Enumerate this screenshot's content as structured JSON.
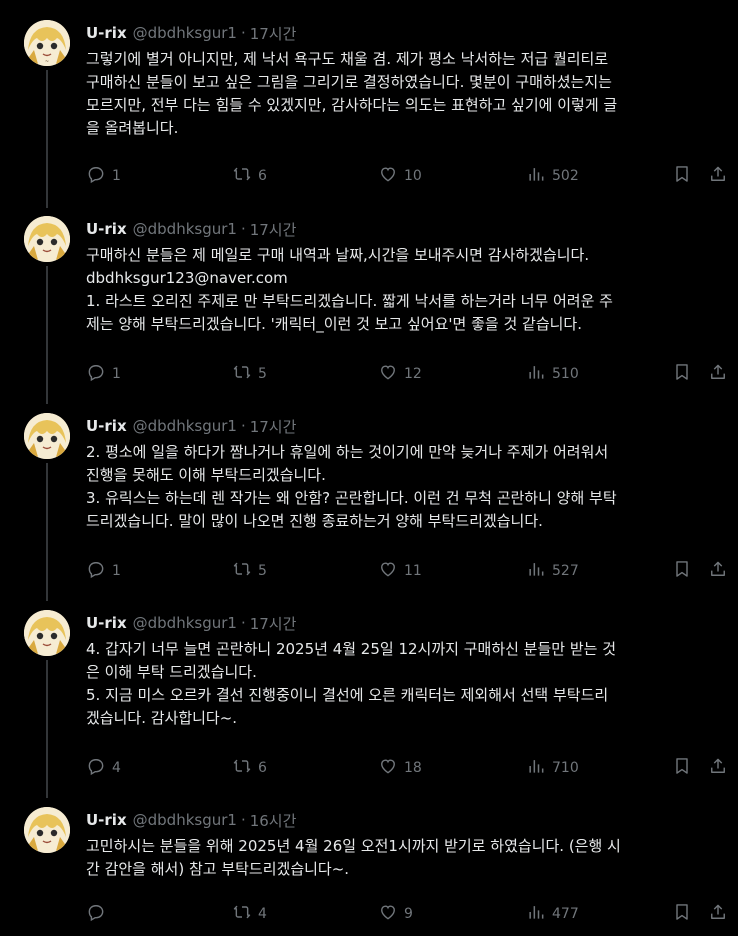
{
  "tweets": [
    {
      "name": "U-rix",
      "handle": "@dbdhksgur1",
      "sep": "·",
      "time": "17시간",
      "text": "그렇기에 별거 아니지만, 제 낙서 욕구도 채울 겸. 제가 평소 낙서하는 저급 퀄리티로\n구매하신 분들이 보고 싶은 그림을 그리기로 결정하였습니다. 몇분이 구매하셨는지는\n모르지만, 전부 다는 힘들 수 있겠지만, 감사하다는 의도는 표현하고 싶기에 이렇게 글\n을 올려봅니다.",
      "replies": "1",
      "reposts": "6",
      "likes": "10",
      "views": "502"
    },
    {
      "name": "U-rix",
      "handle": "@dbdhksgur1",
      "sep": "·",
      "time": "17시간",
      "text": "구매하신 분들은 제 메일로 구매 내역과 날짜,시간을 보내주시면 감사하겠습니다.\ndbdhksgur123@naver.com\n1. 라스트 오리진 주제로 만 부탁드리겠습니다. 짧게 낙서를 하는거라 너무 어려운 주\n제는 양해 부탁드리겠습니다. '캐릭터_이런 것 보고 싶어요'면 좋을 것 같습니다.",
      "replies": "1",
      "reposts": "5",
      "likes": "12",
      "views": "510"
    },
    {
      "name": "U-rix",
      "handle": "@dbdhksgur1",
      "sep": "·",
      "time": "17시간",
      "text": "2. 평소에 일을 하다가 짬나거나 휴일에 하는 것이기에 만약 늦거나 주제가 어려워서\n진행을 못해도 이해 부탁드리겠습니다.\n3. 유릭스는 하는데 렌 작가는 왜 안함? 곤란합니다. 이런 건 무척 곤란하니 양해 부탁\n드리겠습니다. 말이 많이 나오면 진행 종료하는거 양해 부탁드리겠습니다.",
      "replies": "1",
      "reposts": "5",
      "likes": "11",
      "views": "527"
    },
    {
      "name": "U-rix",
      "handle": "@dbdhksgur1",
      "sep": "·",
      "time": "17시간",
      "text": "4. 갑자기 너무 늘면 곤란하니 2025년 4월 25일 12시까지 구매하신 분들만 받는 것\n은 이해 부탁 드리겠습니다.\n5. 지금 미스 오르카 결선 진행중이니 결선에 오른 캐릭터는 제외해서 선택 부탁드리\n겠습니다. 감사합니다~.",
      "replies": "4",
      "reposts": "6",
      "likes": "18",
      "views": "710"
    },
    {
      "name": "U-rix",
      "handle": "@dbdhksgur1",
      "sep": "·",
      "time": "16시간",
      "text": "고민하시는 분들을 위해 2025년 4월 26일 오전1시까지 받기로 하였습니다. (은행 시\n간 감안을 해서) 참고 부탁드리겠습니다~.",
      "replies": "",
      "reposts": "4",
      "likes": "9",
      "views": "477"
    }
  ],
  "icons": {
    "reply": "reply-icon",
    "repost": "repost-icon",
    "like": "heart-icon",
    "views": "views-icon",
    "bookmark": "bookmark-icon",
    "share": "share-icon"
  },
  "colors": {
    "background": "#000000",
    "text": "#e7e9ea",
    "muted": "#71767b",
    "divider": "#2f3336",
    "thread_line": "#333639"
  }
}
